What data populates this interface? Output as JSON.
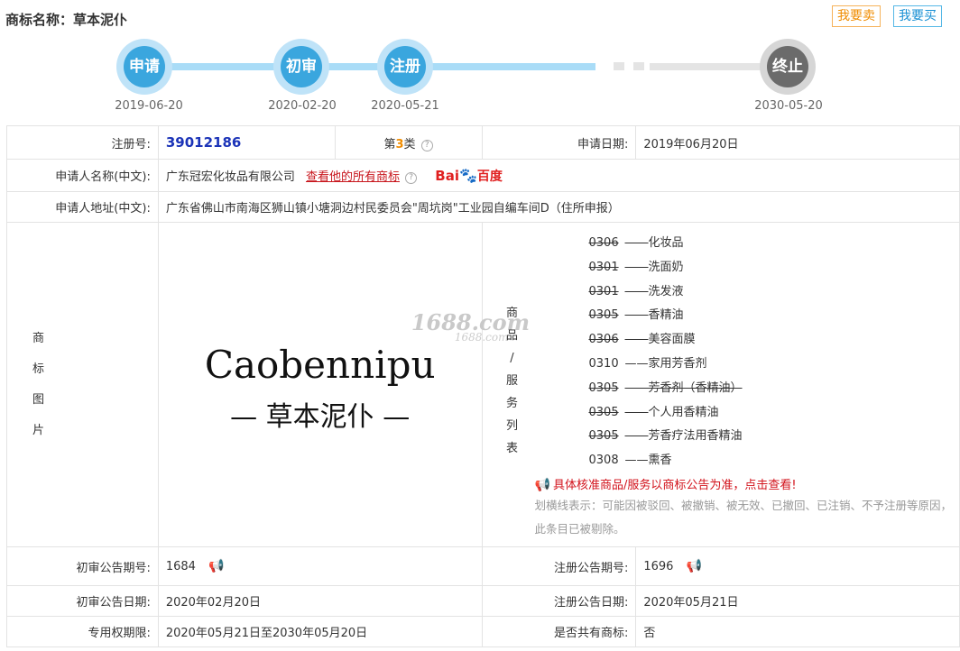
{
  "page": {
    "title": "商标名称：草本泥仆",
    "sell_button": "我要卖",
    "buy_button": "我要买"
  },
  "timeline": [
    {
      "label": "申请",
      "date": "2019-06-20"
    },
    {
      "label": "初审",
      "date": "2020-02-20"
    },
    {
      "label": "注册",
      "date": "2020-05-21"
    },
    {
      "label": "终止",
      "date": "2030-05-20"
    }
  ],
  "info": {
    "reg_no_label": "注册号:",
    "reg_no": "39012186",
    "class_prefix": "第",
    "class_num": "3",
    "class_suffix": "类",
    "apply_date_label": "申请日期:",
    "apply_date": "2019年06月20日",
    "applicant_label": "申请人名称(中文):",
    "applicant": "广东冠宏化妆品有限公司",
    "applicant_link": "查看他的所有商标",
    "baidu_left": "Bai",
    "baidu_right": "百度",
    "address_label": "申请人地址(中文):",
    "address": "广东省佛山市南海区狮山镇小塘洞边村民委员会\"周坑岗\"工业园自编车间D（住所申报）",
    "logo_label": [
      "商",
      "标",
      "图",
      "片"
    ],
    "logo_en": "Caobennipu",
    "logo_cn": "— 草本泥仆 —",
    "watermark": "1688.com",
    "watermark_small": "1688.com",
    "goods_label": [
      "商",
      "品",
      "/",
      "服",
      "务",
      "列",
      "表"
    ],
    "goods": [
      {
        "code": "0306",
        "name": "化妆品",
        "struck": "code"
      },
      {
        "code": "0301",
        "name": "洗面奶",
        "struck": "code"
      },
      {
        "code": "0301",
        "name": "洗发液",
        "struck": "code"
      },
      {
        "code": "0305",
        "name": "香精油",
        "struck": "code"
      },
      {
        "code": "0306",
        "name": "美容面膜",
        "struck": "code"
      },
      {
        "code": "0310",
        "name": "家用芳香剂",
        "struck": "none"
      },
      {
        "code": "0305",
        "name": "芳香剂（香精油）",
        "struck": "all"
      },
      {
        "code": "0305",
        "name": "个人用香精油",
        "struck": "code"
      },
      {
        "code": "0305",
        "name": "芳香疗法用香精油",
        "struck": "code"
      },
      {
        "code": "0308",
        "name": "熏香",
        "struck": "none"
      }
    ],
    "goods_dash": "——",
    "goods_notice": "具体核准商品/服务以商标公告为准，点击查看!",
    "goods_note": "划横线表示：可能因被驳回、被撤销、被无效、已撤回、已注销、不予注册等原因，此条目已被剔除。",
    "prelim_no_label": "初审公告期号:",
    "prelim_no": "1684",
    "reg_pub_no_label": "注册公告期号:",
    "reg_pub_no": "1696",
    "prelim_date_label": "初审公告日期:",
    "prelim_date": "2020年02月20日",
    "reg_pub_date_label": "注册公告日期:",
    "reg_pub_date": "2020年05月21日",
    "exclusive_label": "专用权期限:",
    "exclusive": "2020年05月21日至2030年05月20日",
    "shared_label": "是否共有商标:",
    "shared": "否"
  }
}
